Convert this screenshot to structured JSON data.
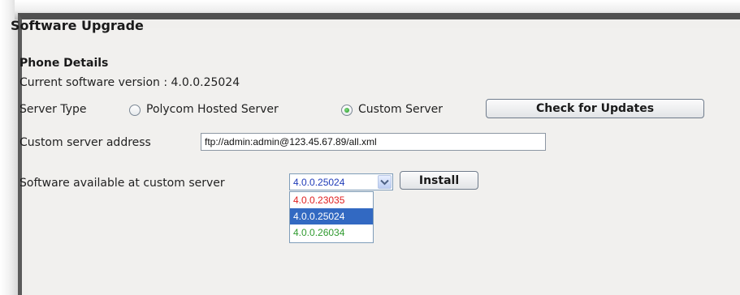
{
  "page": {
    "title": "Software Upgrade",
    "phone_details_heading": "Phone Details",
    "current_version_label": "Current software version :",
    "current_version_value": "4.0.0.25024"
  },
  "server_type": {
    "label": "Server Type",
    "options": [
      {
        "label": "Polycom Hosted Server",
        "selected": false
      },
      {
        "label": "Custom Server",
        "selected": true
      }
    ],
    "check_updates_label": "Check for Updates"
  },
  "custom_server": {
    "address_label": "Custom server address",
    "address_value": "ftp://admin:admin@123.45.67.89/all.xml"
  },
  "software_available": {
    "label": "Software available at custom server",
    "selected_value": "4.0.0.25024",
    "install_label": "Install",
    "options": [
      {
        "label": "4.0.0.23035",
        "color": "#e02020",
        "highlighted": false
      },
      {
        "label": "4.0.0.25024",
        "color": "#ffffff",
        "highlighted": true
      },
      {
        "label": "4.0.0.26034",
        "color": "#2f9a2f",
        "highlighted": false
      }
    ]
  },
  "colors": {
    "highlight": "#3269c2",
    "select_text": "#1f3bb8"
  },
  "icons": {
    "dropdown": "chevron-down-icon"
  }
}
